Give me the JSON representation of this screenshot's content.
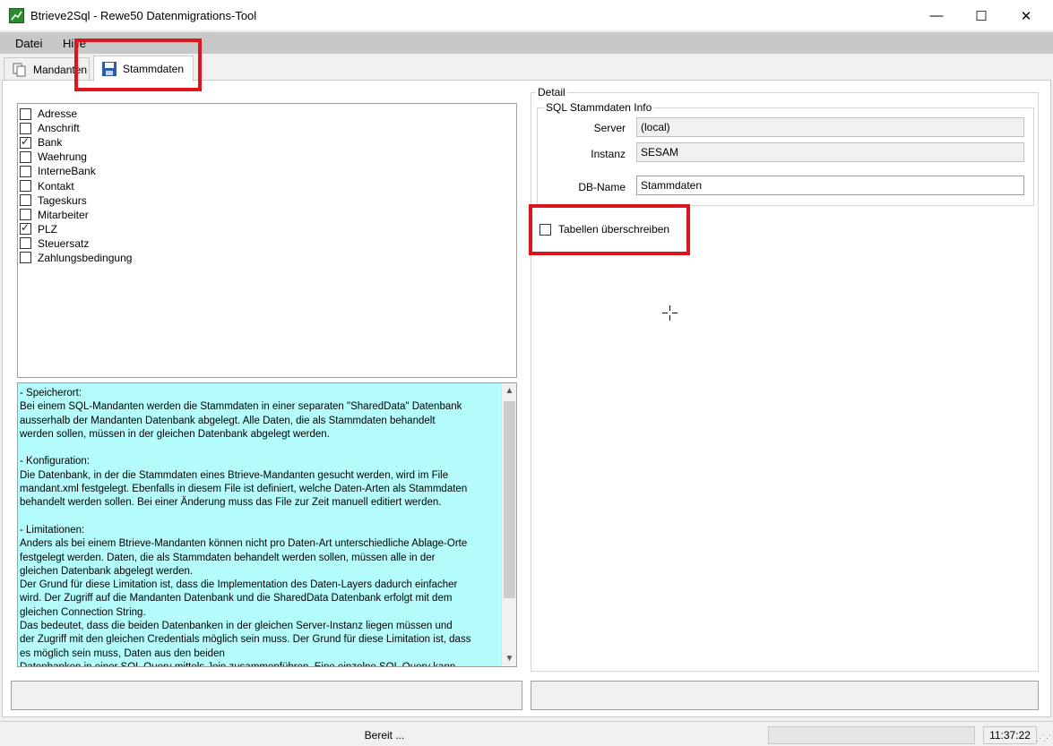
{
  "window": {
    "title": "Btrieve2Sql - Rewe50 Datenmigrations-Tool",
    "minimize": "—",
    "maximize": "☐",
    "close": "✕",
    "icon": "chart-icon",
    "icon_color": "#2e8b2e"
  },
  "menu": {
    "items": [
      "Datei",
      "Hilfe"
    ]
  },
  "tabs": [
    {
      "label": "Mandanten",
      "icon": "copy-icon"
    },
    {
      "label": "Stammdaten",
      "icon": "save-icon",
      "active": true
    }
  ],
  "tables": {
    "items": [
      {
        "label": "Adresse",
        "checked": false
      },
      {
        "label": "Anschrift",
        "checked": false
      },
      {
        "label": "Bank",
        "checked": true
      },
      {
        "label": "Waehrung",
        "checked": false
      },
      {
        "label": "InterneBank",
        "checked": false
      },
      {
        "label": "Kontakt",
        "checked": false
      },
      {
        "label": "Tageskurs",
        "checked": false
      },
      {
        "label": "Mitarbeiter",
        "checked": false
      },
      {
        "label": "PLZ",
        "checked": true
      },
      {
        "label": "Steuersatz",
        "checked": false
      },
      {
        "label": "Zahlungsbedingung",
        "checked": false
      }
    ]
  },
  "info": {
    "text": "- Speicherort:\nBei einem SQL-Mandanten werden die Stammdaten in einer separaten \"SharedData\" Datenbank\nausserhalb der Mandanten Datenbank abgelegt. Alle Daten, die als Stammdaten behandelt\nwerden sollen, müssen in der gleichen Datenbank abgelegt werden.\n\n- Konfiguration:\nDie Datenbank, in der die Stammdaten eines Btrieve-Mandanten gesucht werden, wird im File\nmandant.xml festgelegt. Ebenfalls in diesem File ist definiert, welche Daten-Arten als Stammdaten\nbehandelt werden sollen. Bei einer Änderung muss das File zur Zeit manuell editiert werden.\n\n- Limitationen:\nAnders als bei einem Btrieve-Mandanten können nicht pro Daten-Art unterschiedliche Ablage-Orte\nfestgelegt werden. Daten, die als Stammdaten behandelt werden sollen, müssen alle in der\ngleichen Datenbank abgelegt werden.\nDer Grund für diese Limitation ist, dass die Implementation des Daten-Layers dadurch einfacher\nwird. Der Zugriff auf die Mandanten Datenbank und die SharedData Datenbank erfolgt mit dem\ngleichen Connection String.\nDas bedeutet, dass die beiden Datenbanken in der gleichen Server-Instanz liegen müssen und\nder Zugriff mit den gleichen Credentials möglich sein muss. Der Grund für diese Limitation ist, dass\nes möglich sein muss, Daten aus den beiden\nDatenbanken in einer SQL Query mittels Join zusammenführen. Eine einzelne SQL Query kann",
    "background": "#b4fcfc"
  },
  "detail": {
    "legend": "Detail",
    "sql_info_legend": "SQL Stammdaten Info",
    "server_label": "Server",
    "server_value": "(local)",
    "instance_label": "Instanz",
    "instance_value": "SESAM",
    "dbname_label": "DB-Name",
    "dbname_value": "Stammdaten",
    "overwrite_label": "Tabellen überschreiben",
    "overwrite_checked": false
  },
  "statusbar": {
    "text": "Bereit ...",
    "time": "11:37:22"
  },
  "highlight_color": "#e0141b"
}
